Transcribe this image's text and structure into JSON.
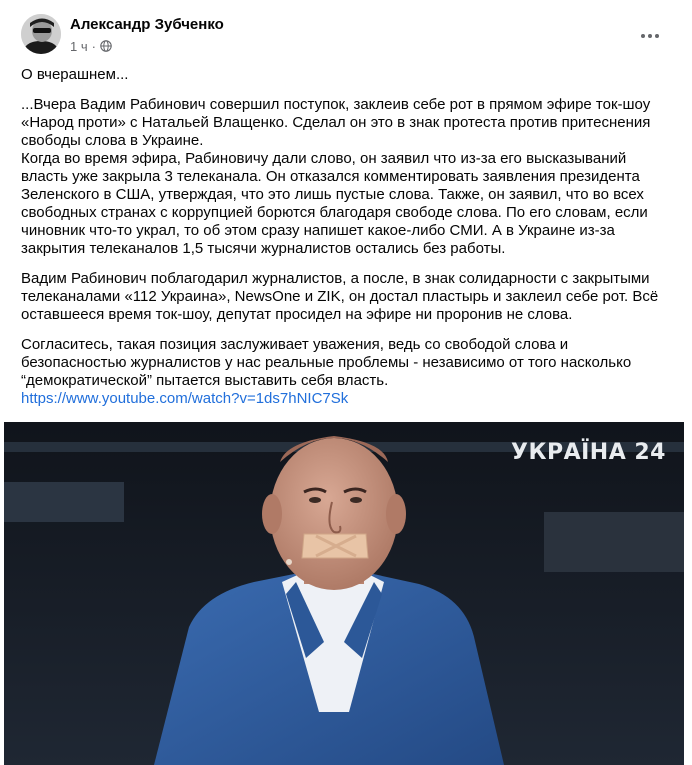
{
  "post": {
    "author": "Александр Зубченко",
    "time": "1 ч",
    "intro": "О вчерашнем...",
    "paragraph1": "...Вчера Вадим Рабинович совершил поступок, заклеив себе рот в прямом эфире ток-шоу «Народ проти» с Натальей Влащенко. Сделал он это в знак протеста против притеснения свободы слова в Украине.",
    "paragraph2": "Когда во время эфира, Рабиновичу дали слово, он заявил что из-за его высказываний власть уже закрыла 3 телеканала. Он отказался комментировать заявления президента Зеленского в США, утверждая, что это лишь пустые слова. Также, он заявил, что во всех свободных странах с коррупцией борются благодаря свободе слова. По его словам, если чиновник что-то украл, то об этом сразу напишет какое-либо СМИ. А в Украине из-за закрытия телеканалов 1,5 тысячи журналистов остались без работы.",
    "paragraph3": "Вадим Рабинович поблагодарил журналистов, а после, в знак солидарности с закрытыми телеканалами «112 Украина», NewsOne и ZIK, он достал пластырь и заклеил себе рот. Всё оставшееся время ток-шоу, депутат просидел на эфире ни проронив не слова.",
    "paragraph4": "Согласитесь, такая позиция заслуживает уважения, ведь со свободой слова и безопасностью журналистов у нас реальные проблемы - независимо от того насколько “демократической” пытается выставить себя власть.",
    "link": "https://www.youtube.com/watch?v=1ds7hNIC7Sk"
  },
  "media": {
    "channel_logo": "УКРАЇНА 24"
  },
  "icons": {
    "privacy": "globe-icon",
    "more": "more-horizontal-icon"
  },
  "colors": {
    "link": "#216fdb",
    "secondary_text": "#65676b",
    "suit": "#2f5d9e"
  }
}
